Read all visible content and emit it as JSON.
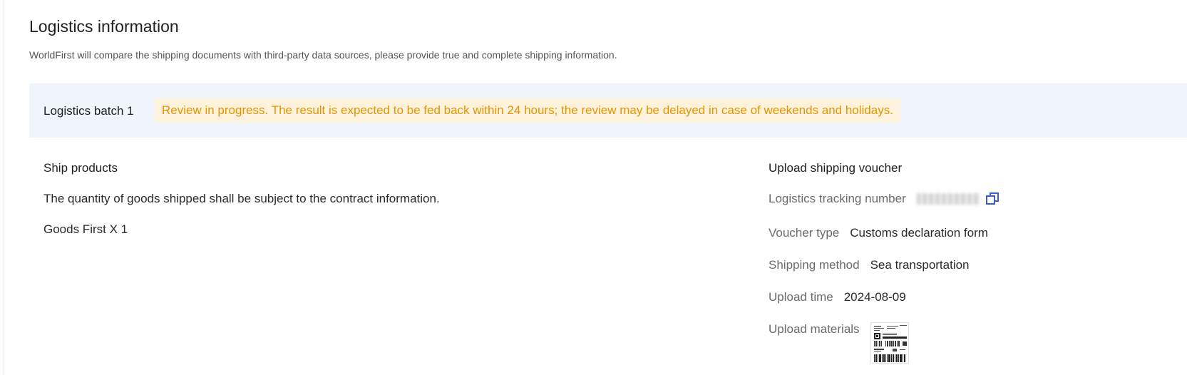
{
  "page": {
    "title": "Logistics information",
    "subtitle": "WorldFirst will compare the shipping documents with third-party data sources, please provide true and complete shipping information."
  },
  "batch": {
    "label": "Logistics batch 1",
    "notice": "Review in progress. The result is expected to be fed back within 24 hours; the review may be delayed in case of weekends and holidays."
  },
  "ship_products": {
    "heading": "Ship products",
    "note": "The quantity of goods shipped shall be subject to the contract information.",
    "item": "Goods First X 1"
  },
  "voucher": {
    "heading": "Upload shipping voucher",
    "tracking_label": "Logistics tracking number",
    "tracking_value": "",
    "type_label": "Voucher type",
    "type_value": "Customs declaration form",
    "method_label": "Shipping method",
    "method_value": "Sea transportation",
    "time_label": "Upload time",
    "time_value": "2024-08-09",
    "materials_label": "Upload materials"
  },
  "colors": {
    "accent": "#3b5bdb",
    "notice_text": "#e59400",
    "notice_bg": "#fdf3dc",
    "batch_bg": "#f0f5fc"
  },
  "icons": {
    "copy": "copy-icon",
    "attachment": "document-thumbnail"
  }
}
